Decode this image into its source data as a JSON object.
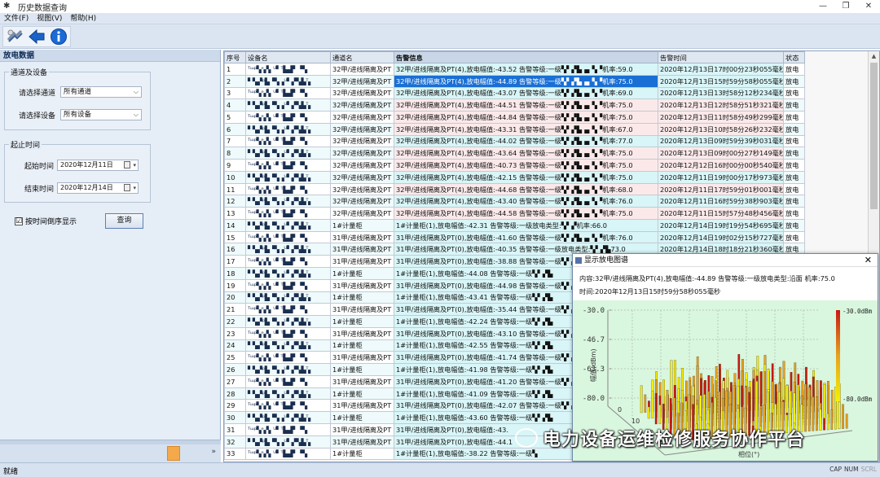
{
  "window": {
    "title": "历史数据查询",
    "minimize": "—",
    "restore": "❐",
    "close": "✕"
  },
  "menu": [
    "文件(F)",
    "视图(V)",
    "帮助(H)"
  ],
  "toolbar": [
    "refresh-icon",
    "back-arrow-icon",
    "info-icon"
  ],
  "left_panel": {
    "header": "放电数据",
    "group_channel": {
      "title": "通道及设备",
      "channel_label": "请选择通道",
      "channel_value": "所有通道",
      "device_label": "请选择设备",
      "device_value": "所有设备"
    },
    "group_time": {
      "title": "起止时间",
      "start_label": "起始时间",
      "start_value": "2020年12月11日",
      "end_label": "结束时间",
      "end_value": "2020年12月14日"
    },
    "reverse_label": "按时间倒序显示",
    "reverse_checked": "☑",
    "query_button": "查询"
  },
  "grid": {
    "columns": [
      "序号",
      "设备名",
      "通道名",
      "告警信息",
      "告警时间",
      "状态"
    ],
    "rows": [
      {
        "no": "1",
        "dev": "ᵀᵚᵖ▚ᵉ▞▖ᵁ▘ᵀ▙▟▘▝▚",
        "ch": "32甲/进线隔离及PT",
        "info": "32甲/进线隔离及PT(4),放电幅值:-43.52 告警等级:一级▚▘▞▙▗▖▚▝机率:59.0",
        "time": "2020年12月13日17时00分23秒055毫秒",
        "status": "放电",
        "hl": "cyan"
      },
      {
        "no": "2",
        "dev": "▘▚▞ᵖ▙▝▚▗ᵁ▘▞▚▙ᵀ▖",
        "ch": "32甲/进线隔离及PT",
        "info": "32甲/进线隔离及PT(4),放电幅值:-44.89 告警等级:一级▚▘▞▙▗▖▚▝机率:75.0",
        "time": "2020年12月13日15时59分58秒055毫秒",
        "status": "放电",
        "hl": "sel"
      },
      {
        "no": "3",
        "dev": "ᵀᵚᵖ▚ᵉ▞▖ᵁ▘ᵀ▙▟▘▝▚",
        "ch": "32甲/进线隔离及PT",
        "info": "32甲/进线隔离及PT(4),放电幅值:-43.07 告警等级:一级▚▘▞▙▗▖▚▝机率:69.0",
        "time": "2020年12月13日13时58分12秒234毫秒",
        "status": "放电",
        "hl": "cyan"
      },
      {
        "no": "4",
        "dev": "▘▚▞ᵖ▙▝▚▗ᵁ▘▞▚▙ᵀ▖",
        "ch": "32甲/进线隔离及PT",
        "info": "32甲/进线隔离及PT(4),放电幅值:-44.51 告警等级:一级▚▘▞▙▗▖▚▝机率:75.0",
        "time": "2020年12月13日12时58分51秒321毫秒",
        "status": "放电",
        "hl": "pink"
      },
      {
        "no": "5",
        "dev": "ᵀᵚᵖ▚ᵉ▞▖ᵁ▘ᵀ▙▟▘▝▚",
        "ch": "32甲/进线隔离及PT",
        "info": "32甲/进线隔离及PT(4),放电幅值:-44.84 告警等级:一级▚▘▞▙▗▖▚▝机率:75.0",
        "time": "2020年12月13日11时58分49秒299毫秒",
        "status": "放电",
        "hl": "pink"
      },
      {
        "no": "6",
        "dev": "▘▚▞ᵖ▙▝▚▗ᵁ▘▞▚▙ᵀ▖",
        "ch": "32甲/进线隔离及PT",
        "info": "32甲/进线隔离及PT(4),放电幅值:-43.31 告警等级:一级▚▘▞▙▗▖▚▝机率:67.0",
        "time": "2020年12月13日10时58分26秒232毫秒",
        "status": "放电",
        "hl": "pink"
      },
      {
        "no": "7",
        "dev": "ᵀᵚᵖ▚ᵉ▞▖ᵁ▘ᵀ▙▟▘▝▚",
        "ch": "32甲/进线隔离及PT",
        "info": "32甲/进线隔离及PT(4),放电幅值:-44.02 告警等级:一级▚▘▞▙▗▖▚▝机率:77.0",
        "time": "2020年12月13日09时59分39秒031毫秒",
        "status": "放电",
        "hl": "cyan"
      },
      {
        "no": "8",
        "dev": "▘▚▞ᵖ▙▝▚▗ᵁ▘▞▚▙ᵀ▖",
        "ch": "32甲/进线隔离及PT",
        "info": "32甲/进线隔离及PT(4),放电幅值:-43.64 告警等级:一级▚▘▞▙▗▖▚▝机率:75.0",
        "time": "2020年12月13日09时00分27秒149毫秒",
        "status": "放电",
        "hl": "pink"
      },
      {
        "no": "9",
        "dev": "ᵀᵚᵖ▚ᵉ▞▖ᵁ▘ᵀ▙▟▘▝▚",
        "ch": "32甲/进线隔离及PT",
        "info": "32甲/进线隔离及PT(4),放电幅值:-40.73 告警等级:一级▚▘▞▙▗▖▚▝机率:75.0",
        "time": "2020年12月12日16时00分00秒540毫秒",
        "status": "放电",
        "hl": "pink"
      },
      {
        "no": "10",
        "dev": "▘▚▞ᵖ▙▝▚▗ᵁ▘▞▚▙ᵀ▖",
        "ch": "32甲/进线隔离及PT",
        "info": "32甲/进线隔离及PT(4),放电幅值:-42.15 告警等级:一级▚▘▞▙▗▖▚▝机率:75.0",
        "time": "2020年12月11日19时00分17秒973毫秒",
        "status": "放电",
        "hl": "cyan"
      },
      {
        "no": "11",
        "dev": "ᵀᵚᵖ▚ᵉ▞▖ᵁ▘ᵀ▙▟▘▝▚",
        "ch": "32甲/进线隔离及PT",
        "info": "32甲/进线隔离及PT(4),放电幅值:-44.68 告警等级:一级▚▘▞▙▗▖▚▝机率:68.0",
        "time": "2020年12月11日17时59分01秒001毫秒",
        "status": "放电",
        "hl": "pink"
      },
      {
        "no": "12",
        "dev": "▘▚▞ᵖ▙▝▚▗ᵁ▘▞▚▙ᵀ▖",
        "ch": "32甲/进线隔离及PT",
        "info": "32甲/进线隔离及PT(4),放电幅值:-43.40 告警等级:一级▚▘▞▙▗▖▚▝机率:76.0",
        "time": "2020年12月11日16时59分38秒903毫秒",
        "status": "放电",
        "hl": "cyan"
      },
      {
        "no": "13",
        "dev": "ᵀᵚᵖ▚ᵉ▞▖ᵁ▘ᵀ▙▟▘▝▚",
        "ch": "32甲/进线隔离及PT",
        "info": "32甲/进线隔离及PT(4),放电幅值:-44.58 告警等级:一级▚▘▞▙▗▖▚▝机率:75.0",
        "time": "2020年12月11日15时57分48秒456毫秒",
        "status": "放电",
        "hl": "pink"
      },
      {
        "no": "14",
        "dev": "▘▚▞ᵖ▙▝▚▗ᵁ▘▞▚▙ᵀ▖",
        "ch": "1#计量柜",
        "info": "1#计量柜(1),放电幅值:-42.31 告警等级:一级放电类型:▚▘▞机率:66.0",
        "time": "2020年12月14日19时19分54秒695毫秒",
        "status": "放电",
        "hl": "cyan"
      },
      {
        "no": "15",
        "dev": "ᵀᵚᵖ▚ᵉ▞▖ᵁ▘ᵀ▙▟▘▝▚",
        "ch": "31甲/进线隔离及PT",
        "info": "31甲/进线隔离及PT(0),放电幅值:-41.60 告警等级:一级▚▘▞▙▗▖▚▝机率:76.0",
        "time": "2020年12月14日19时02分15秒727毫秒",
        "status": "放电",
        "hl": "cyan"
      },
      {
        "no": "16",
        "dev": "▘▚▞ᵖ▙▝▚▗ᵁ▘▞▚▙ᵀ▖",
        "ch": "31甲/进线隔离及PT",
        "info": "31甲/进线隔离及PT(0),放电幅值:-40.35 告警等级:一级放电类型:▚▘▞▙73.0",
        "time": "2020年12月14日18时18分21秒360毫秒",
        "status": "放电",
        "hl": "cyan"
      },
      {
        "no": "17",
        "dev": "ᵀᵚᵖ▚ᵉ▞▖ᵁ▘ᵀ▙▟▘▝▚",
        "ch": "31甲/进线隔离及PT",
        "info": "31甲/进线隔离及PT(0),放电幅值:-38.88 告警等级:一级▚▘▞▙",
        "time": "",
        "status": "",
        "hl": "cyan"
      },
      {
        "no": "18",
        "dev": "▘▚▞ᵖ▙▝▚▗ᵁ▘▞▚▙ᵀ▖",
        "ch": "1#计量柜",
        "info": "1#计量柜(1),放电幅值:-44.08 告警等级:一级▚▘▞▙",
        "time": "",
        "status": "",
        "hl": "cyan"
      },
      {
        "no": "19",
        "dev": "ᵀᵚᵖ▚ᵉ▞▖ᵁ▘ᵀ▙▟▘▝▚",
        "ch": "31甲/进线隔离及PT",
        "info": "31甲/进线隔离及PT(0),放电幅值:-44.98 告警等级:一级▚▘▞▙",
        "time": "",
        "status": "",
        "hl": "cyan"
      },
      {
        "no": "20",
        "dev": "▘▚▞ᵖ▙▝▚▗ᵁ▘▞▚▙ᵀ▖",
        "ch": "1#计量柜",
        "info": "1#计量柜(1),放电幅值:-43.41 告警等级:一级▚▘▞▙",
        "time": "",
        "status": "",
        "hl": "cyan"
      },
      {
        "no": "21",
        "dev": "ᵀᵚᵖ▚ᵉ▞▖ᵁ▘ᵀ▙▟▘▝▚",
        "ch": "31甲/进线隔离及PT",
        "info": "31甲/进线隔离及PT(0),放电幅值:-35.44 告警等级:一级▚▘▞▙",
        "time": "",
        "status": "",
        "hl": "cyan"
      },
      {
        "no": "22",
        "dev": "▘▚▞ᵖ▙▝▚▗ᵁ▘▞▚▙ᵀ▖",
        "ch": "1#计量柜",
        "info": "1#计量柜(1),放电幅值:-42.24 告警等级:一级▚▘▞▙",
        "time": "",
        "status": "",
        "hl": "cyan"
      },
      {
        "no": "23",
        "dev": "ᵀᵚᵖ▚ᵉ▞▖ᵁ▘ᵀ▙▟▘▝▚",
        "ch": "31甲/进线隔离及PT",
        "info": "31甲/进线隔离及PT(0),放电幅值:-43.10 告警等级:一级▚▘▞▙",
        "time": "",
        "status": "",
        "hl": "cyan"
      },
      {
        "no": "24",
        "dev": "▘▚▞ᵖ▙▝▚▗ᵁ▘▞▚▙ᵀ▖",
        "ch": "1#计量柜",
        "info": "1#计量柜(1),放电幅值:-42.55 告警等级:一级▚▘▞▙",
        "time": "",
        "status": "",
        "hl": "cyan"
      },
      {
        "no": "25",
        "dev": "ᵀᵚᵖ▚ᵉ▞▖ᵁ▘ᵀ▙▟▘▝▚",
        "ch": "31甲/进线隔离及PT",
        "info": "31甲/进线隔离及PT(0),放电幅值:-41.74 告警等级:一级▚▘▞▙",
        "time": "",
        "status": "",
        "hl": "cyan"
      },
      {
        "no": "26",
        "dev": "▘▚▞ᵖ▙▝▚▗ᵁ▘▞▚▙ᵀ▖",
        "ch": "1#计量柜",
        "info": "1#计量柜(1),放电幅值:-41.98 告警等级:一级▚▘▞▙",
        "time": "",
        "status": "",
        "hl": "cyan"
      },
      {
        "no": "27",
        "dev": "ᵀᵚᵖ▚ᵉ▞▖ᵁ▘ᵀ▙▟▘▝▚",
        "ch": "31甲/进线隔离及PT",
        "info": "31甲/进线隔离及PT(0),放电幅值:-41.20 告警等级:一级▚▘▞▙",
        "time": "",
        "status": "",
        "hl": "cyan"
      },
      {
        "no": "28",
        "dev": "▘▚▞ᵖ▙▝▚▗ᵁ▘▞▚▙ᵀ▖",
        "ch": "1#计量柜",
        "info": "1#计量柜(1),放电幅值:-41.09 告警等级:一级▚▘▞▙",
        "time": "",
        "status": "",
        "hl": "cyan"
      },
      {
        "no": "29",
        "dev": "ᵀᵚᵖ▚ᵉ▞▖ᵁ▘ᵀ▙▟▘▝▚",
        "ch": "31甲/进线隔离及PT",
        "info": "31甲/进线隔离及PT(0),放电幅值:-42.07 告警等级:一级▚▘▞▙",
        "time": "",
        "status": "",
        "hl": "cyan"
      },
      {
        "no": "30",
        "dev": "▘▚▞ᵖ▙▝▚▗ᵁ▘▞▚▙ᵀ▖",
        "ch": "1#计量柜",
        "info": "1#计量柜(1),放电幅值:-43.60 告警等级:一级▚▘▞▙",
        "time": "",
        "status": "",
        "hl": "cyan"
      },
      {
        "no": "31",
        "dev": "ᵀᵚᵖ▚ᵉ▞▖ᵁ▘ᵀ▙▟▘▝▚",
        "ch": "31甲/进线隔离及PT",
        "info": "31甲/进线隔离及PT(0),放电幅值:-43.",
        "time": "",
        "status": "",
        "hl": "cyan"
      },
      {
        "no": "32",
        "dev": "▘▚▞ᵖ▙▝▚▗ᵁ▘▞▚▙ᵀ▖",
        "ch": "31甲/进线隔离及PT",
        "info": "31甲/进线隔离及PT(0),放电幅值:-44.1",
        "time": "",
        "status": "",
        "hl": "cyan"
      },
      {
        "no": "33",
        "dev": "ᵀᵚᵖ▚ᵉ▞▖ᵁ▘ᵀ▙▟▘▝▚",
        "ch": "1#计量柜",
        "info": "1#计量柜(1),放电幅值:-38.22 告警等级:一级▚",
        "time": "",
        "status": "",
        "hl": "cyan"
      }
    ]
  },
  "popup": {
    "title": "显示放电图谱",
    "close": "✕",
    "content_line": "内容:32甲/进线隔离及PT(4),放电幅值:-44.89 告警等级:一级放电类型:沿面 机率:75.0",
    "time_line": "时间:2020年12月13日15时59分58秒055毫秒"
  },
  "chart_data": {
    "type": "bar",
    "yticks": [
      "-30.0",
      "-46.7",
      "-63.3",
      "-80.0"
    ],
    "ylabel": "幅值(dBm)",
    "depth_ticks": [
      "0",
      "10",
      "20",
      "30"
    ],
    "xlabel": "相位(°)",
    "colorbar_max": "-30.0dBm",
    "colorbar_min": "-80.0dBm",
    "ylim": [
      -80.0,
      -30.0
    ],
    "colors": {
      "low": "#f5f000",
      "mid": "#e6a21e",
      "high": "#c81a12",
      "background": "#d9f6de"
    }
  },
  "watermark": "电力设备运维检修服务协作平台",
  "status": {
    "text": "就绪",
    "keys": [
      "CAP",
      "NUM",
      "SCRL"
    ]
  }
}
